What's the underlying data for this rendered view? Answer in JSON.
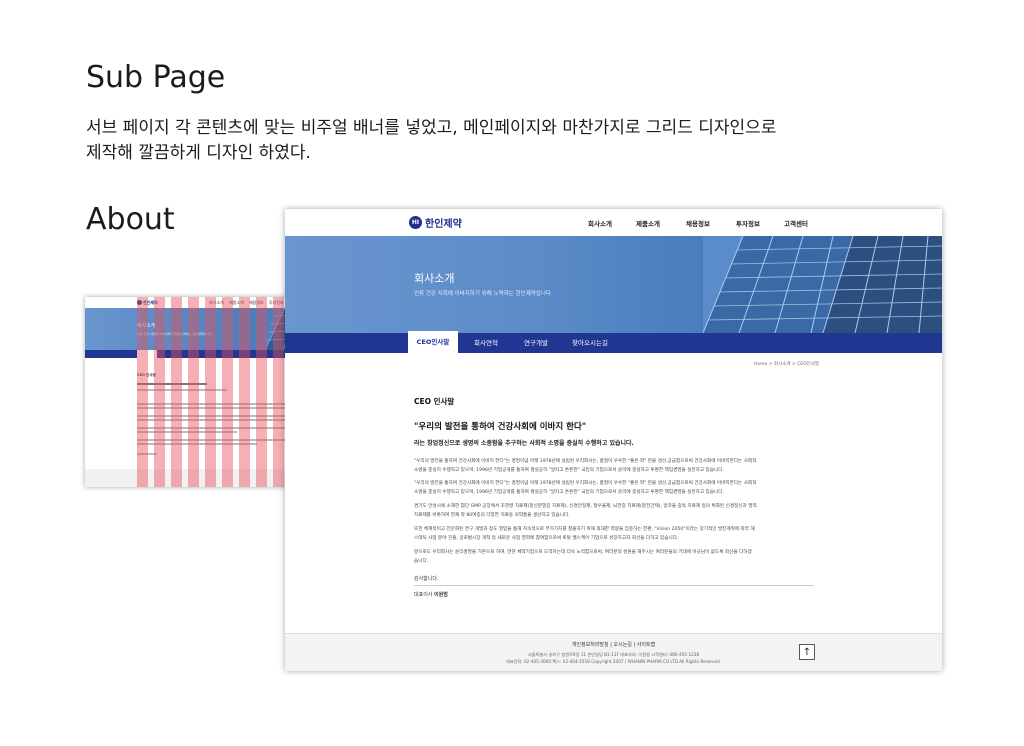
{
  "heading": "Sub Page",
  "description_lines": [
    "서브 페이지 각 콘텐츠에 맞는 비주얼 배너를 넣었고, 메인페이지와 마찬가지로 그리드 디자인으로",
    "제작해 깔끔하게 디자인 하였다."
  ],
  "section_title": "About",
  "site": {
    "logo_text": "한인제약",
    "nav": [
      "회사소개",
      "제품소개",
      "채용정보",
      "투자정보",
      "고객센터"
    ],
    "hero_title": "회사소개",
    "hero_subtitle": "인류 건강 사회에 이바지하기 위해 노력하는 한인제약입니다.",
    "tabs": [
      "CEO인사말",
      "회사연혁",
      "연구개발",
      "찾아오시는길"
    ],
    "active_tab_index": 0,
    "breadcrumb": "Home > 회사소개 > CEO인사말",
    "content_title": "CEO 인사말",
    "quote": "\"우리의 발전을 통하여 건강사회에 이바지 한다\"",
    "quote_sub": "라는 창업정신으로 생명의 소중함을 추구하는 사회적 소명을 충실히 수행하고 있습니다.",
    "paragraphs": [
      [
        "\"우리의 발전을 통하여 건강사회에 이바지 한다\"는 경영이념 아래 1978년에 설립된 우리회사는, 품질이 우수한 \"좋은 약\" 만을 생산,공급함으로써 건강사회에 이바지한다는 사회적",
        "소명을 충실히 수행하고 있으며, 1996년 기업공개를 통하여 명실공히 \"알차고 튼튼한\" 국민의 기업으로서 윤리에 충실하고 투명한 책임경영을 실천하고 있습니다."
      ],
      [
        "\"우리의 발전을 통하여 건강사회에 이바지 한다\"는 경영이념 아래 1978년에 설립된 우리회사는, 품질이 우수한 \"좋은 약\" 만을 생산,공급함으로써 건강사회에 이바지한다는 사회적",
        "소명을 충실히 수행하고 있으며, 1996년 기업공개를 통하여 명실공히 \"알차고 튼튼한\" 국민의 기업으로서 윤리에 충실하고 투명한 책임경영을 실천하고 있습니다."
      ],
      [
        "경기도 안성시에 소재한 첨단 GMP 공장에서 조현병 치료제(정신분열증 치료제), 신경안정제, 항우울제, 뇌전증 치료제(항전간제), 알코올 중독 치료제 등의 특화된 신경정신과 영역",
        "치료제를 비롯하여 현재 약 80여종의 다양한 치료용 의약품을 생산하고 있습니다."
      ],
      [
        "또한 체계적이고 전문화된 연구 개발과 정도 영업을 통해 지속적으로 부가가치를 창출하기 위해 최대한 역량을 집중하는 한편, \"Vision 2050\"이라는 장기적인 발전계획에 따라 해",
        "스테틱 사업 분야 진출, 글로벌시장 개척 등 새로운 사업 영역에 참여함으로써 토탈 헬스케어 기업으로 성장하고자 최선을 다하고 있습니다."
      ],
      [
        "앞으로도 우리회사는 윤리경영을 기본으로 하여, 연찬 체약기업으로 도약하는데 더욱 노력함으로써, 여러분의 성원을 해주시는 여러분들의 기대에 어긋남이 없도록 최선을 다하겠",
        "습니다."
      ]
    ],
    "thanks": "감사합니다.",
    "ceo_label": "대표이사",
    "ceo_name": "이원범",
    "footer_links": "개인정보처리방침  |  오시는길  |  사이트맵",
    "footer_address": "서울특별시 송파구 법원로9길 11 한인빌딩 B1-11F 대표자외: 이원범 고객센터: 080-405-1238",
    "footer_copy": "대표전화: 02-405-3000 팩스: 02-404-2518 Copyright 2007 / WHANIN PHARM.CO.LTD.All Rights Reserved.",
    "top_button": "↑"
  },
  "colors": {
    "brand_navy": "#213593",
    "hero_blue": "#5b8bc7",
    "grid_overlay": "#e6505a"
  }
}
